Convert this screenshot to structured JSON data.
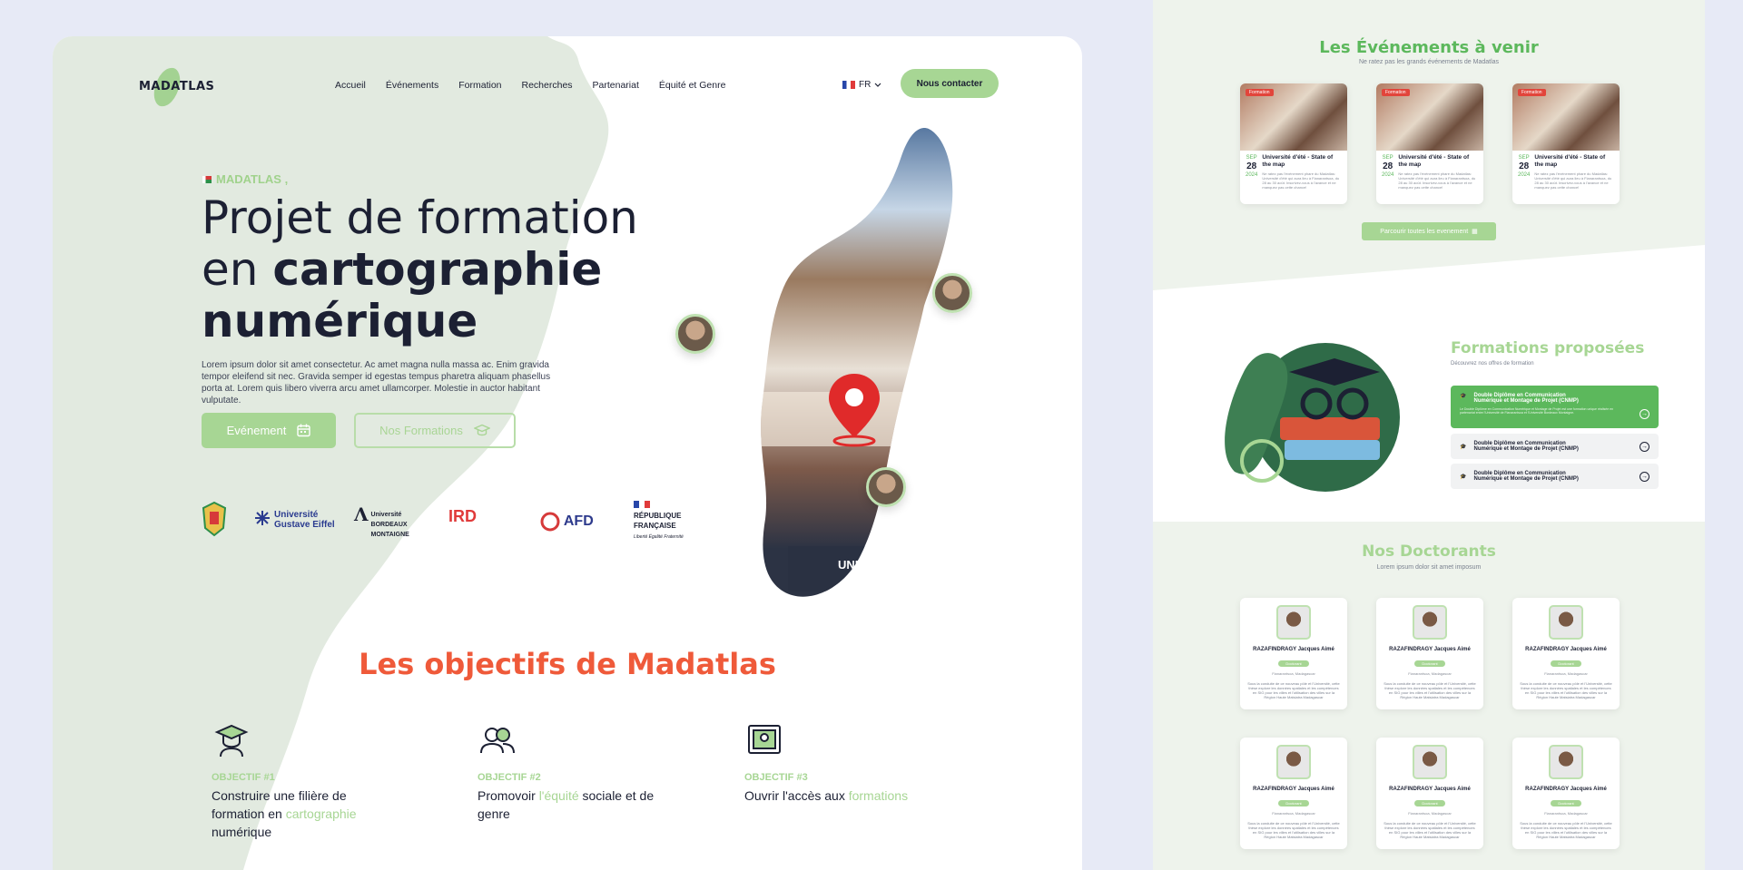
{
  "nav": {
    "logo": "MADATLAS",
    "items": [
      "Accueil",
      "Événements",
      "Formation",
      "Recherches",
      "Partenariat",
      "Équité et Genre"
    ],
    "lang": "FR",
    "contact": "Nous contacter"
  },
  "hero": {
    "eyebrow": "MADATLAS ,",
    "title_line1": "Projet de formation",
    "title_line2_prefix": "en ",
    "title_line2_bold": "cartographie",
    "title_line3_bold": "numérique",
    "lead": "Lorem ipsum dolor sit amet consectetur. Ac amet magna nulla massa ac. Enim gravida tempor eleifend sit nec. Gravida semper id egestas tempus pharetra aliquam phasellus porta at. Lorem quis libero viverra arcu amet ullamcorper. Molestie in auctor habitant vulputate.",
    "btn_event": "Evénement",
    "btn_formations": "Nos Formations",
    "sign": "UNIVERSITE DE FIANARANTSOA"
  },
  "partners": {
    "eiffel": "Université Gustave Eiffel",
    "bordeaux": "Université BORDEAUX MONTAIGNE",
    "ird": "IRD",
    "afd": "AFD",
    "rf": "RÉPUBLIQUE FRANÇAISE",
    "rf_motto": "Liberté Égalité Fraternité"
  },
  "objectives": {
    "title": "Les objectifs de Madatlas",
    "items": [
      {
        "label": "OBJECTIF #1",
        "pre": "Construire une filière de formation en ",
        "hl": "cartographie",
        "post": " numérique"
      },
      {
        "label": "OBJECTIF #2",
        "pre": "Promovoir ",
        "hl": "l'équité",
        "post": " sociale et de genre"
      },
      {
        "label": "OBJECTIF #3",
        "pre": "Ouvrir l'accès aux ",
        "hl": "formations",
        "post": ""
      }
    ]
  },
  "events": {
    "title": "Les Événements à venir",
    "subtitle": "Ne ratez pas les grands événements de Madatlas",
    "tag": "Formation",
    "month": "SEP",
    "day": "28",
    "year": "2024",
    "card_title": "Université d'été - State of the map",
    "card_desc": "Ne ratez pas l'événement phare du Madatlas: Université d'été qui aura lieu à Fianarantsoa, du 28 au 30 août. Inscrivez-vous à l'avance et ne manquez pas cette chance!",
    "all_button": "Parcourir toutes les evenement"
  },
  "formations": {
    "title": "Formations proposées",
    "subtitle": "Découvrez nos offres de formation",
    "items": [
      {
        "label": "Double Diplôme en Communication Numérique et Montage de Projet (CNMP)",
        "desc": "Le Double Diplôme en Communication Numérique et Montage de Projet est une formation unique réalisée en partenariat entre l'Université de Fianarantsoa et l'Université Bordeaux Montaigne."
      },
      {
        "label": "Double Diplôme en Communication Numérique et Montage de Projet (CNMP)"
      },
      {
        "label": "Double Diplôme en Communication Numérique et Montage de Projet (CNMP)"
      }
    ]
  },
  "doctorants": {
    "title": "Nos Doctorants",
    "subtitle": "Lorem ipsum dolor sit amet imposum",
    "name": "RAZAFINDRAGY Jacques Aimé",
    "badge": "Doctorant",
    "loc": "Fianarantsoa, Madagascar",
    "desc": "Sous la conduite de ce nouveau pôle et l'Université, cette thèse explore les données spatiales et les compétences en SIG pour les villes et l'utilisation des villes sur la Région Haute Matsiatra Madagascar"
  },
  "colors": {
    "accent": "#a7d694",
    "orange": "#ef5a3a",
    "green": "#5cb85c"
  }
}
